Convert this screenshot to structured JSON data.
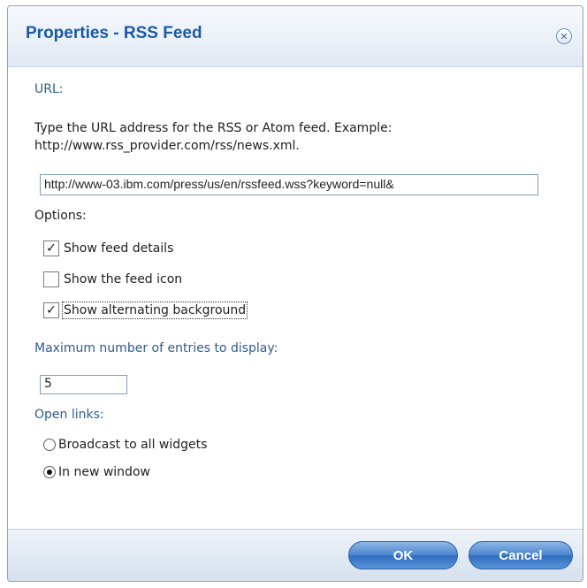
{
  "dialog": {
    "title": "Properties - RSS Feed",
    "close_icon": "close-circle-icon"
  },
  "url_section": {
    "label": "URL:",
    "description_line1": "Type the URL address for the RSS or Atom feed. Example:",
    "description_line2": "http://www.rss_provider.com/rss/news.xml.",
    "value": "http://www-03.ibm.com/press/us/en/rssfeed.wss?keyword=null&"
  },
  "options": {
    "label": "Options:",
    "items": [
      {
        "label": "Show feed details",
        "checked": true
      },
      {
        "label": "Show the feed icon",
        "checked": false
      },
      {
        "label": "Show alternating background",
        "checked": true
      }
    ]
  },
  "max_entries": {
    "label": "Maximum number of entries to display:",
    "value": "5"
  },
  "open_links": {
    "label": "Open links:",
    "options": [
      {
        "label": "Broadcast to all widgets",
        "selected": false
      },
      {
        "label": "In new window",
        "selected": true
      }
    ]
  },
  "footer": {
    "ok_label": "OK",
    "cancel_label": "Cancel"
  },
  "colors": {
    "title": "#1b5aa8",
    "section_label": "#2e5c8f",
    "button": "#3b78c9"
  }
}
